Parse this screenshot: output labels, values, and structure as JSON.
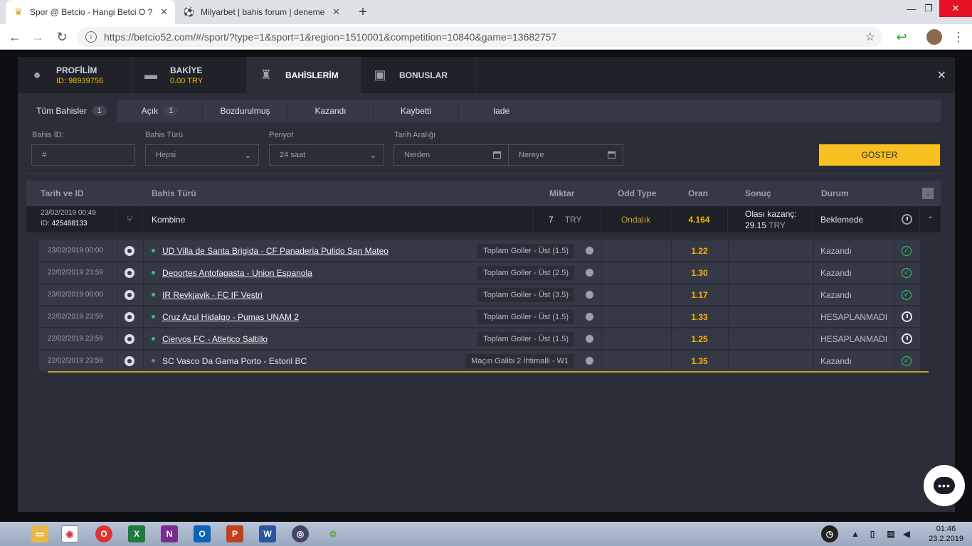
{
  "browser": {
    "tabs": [
      {
        "title": "Spor @ Betcio - Hangi Betci O ?",
        "active": true
      },
      {
        "title": "Milyarbet | bahis forum | deneme",
        "active": false
      }
    ],
    "url": "https://betcio52.com/#/sport/?type=1&sport=1&region=1510001&competition=10840&game=13682757"
  },
  "modal": {
    "tabs": [
      {
        "label": "PROFİLİM",
        "sub": "ID: 98939756"
      },
      {
        "label": "BAKİYE",
        "sub": "0.00 TRY"
      },
      {
        "label": "BAHİSLERİM",
        "sub": ""
      },
      {
        "label": "BONUSLAR",
        "sub": ""
      }
    ],
    "subtabs": [
      {
        "label": "Tüm Bahisler",
        "count": "1"
      },
      {
        "label": "Açık",
        "count": "1"
      },
      {
        "label": "Bozdurulmuş",
        "count": ""
      },
      {
        "label": "Kazandı",
        "count": ""
      },
      {
        "label": "Kaybetti",
        "count": ""
      },
      {
        "label": "Iade",
        "count": ""
      }
    ],
    "filters": {
      "bet_id_label": "Bahis İD:",
      "bet_id_placeholder": "#",
      "bet_type_label": "Bahis Türü",
      "bet_type_value": "Hepsi",
      "period_label": "Periyot",
      "period_value": "24 saat",
      "date_range_label": "Tarih Aralığı",
      "from_placeholder": "Nerden",
      "to_placeholder": "Nereye",
      "show_button": "GÖSTER"
    },
    "table": {
      "headers": [
        "Tarih ve ID",
        "Bahis Türü",
        "Miktar",
        "Odd Type",
        "Oran",
        "Sonuç",
        "Durum"
      ],
      "bet": {
        "date": "23/02/2019 00:49",
        "id_label": "ID:",
        "id": "425488133",
        "type": "Kombine",
        "amount": "7",
        "currency": "TRY",
        "odd_type": "Ondalık",
        "odds": "4.164",
        "possible_win_label": "Olası kazanç:",
        "possible_win": "29.15",
        "possible_win_currency": "TRY",
        "status": "Beklemede"
      },
      "selections": [
        {
          "date": "23/02/2019 00:00",
          "match": "UD Villa de Santa Brigida - CF Panaderia Pulido San Mateo",
          "market": "Toplam Goller - Üst (1.5)",
          "odds": "1.22",
          "status": "Kazandı",
          "state": "won",
          "sport": "football"
        },
        {
          "date": "22/02/2019 23:59",
          "match": "Deportes Antofagasta - Union Espanola",
          "market": "Toplam Goller - Üst (2.5)",
          "odds": "1.30",
          "status": "Kazandı",
          "state": "won",
          "sport": "football"
        },
        {
          "date": "23/02/2019 00:00",
          "match": "IR Reykjavik - FC IF Vestri",
          "market": "Toplam Goller - Üst (3.5)",
          "odds": "1.17",
          "status": "Kazandı",
          "state": "won",
          "sport": "football"
        },
        {
          "date": "22/02/2019 23:59",
          "match": "Cruz Azul Hidalgo - Pumas UNAM 2",
          "market": "Toplam Goller - Üst (1.5)",
          "odds": "1.33",
          "status": "HESAPLANMADI",
          "state": "pending",
          "sport": "football"
        },
        {
          "date": "22/02/2019 23:59",
          "match": "Ciervos FC - Atletico Saltillo",
          "market": "Toplam Goller - Üst (1.5)",
          "odds": "1.25",
          "status": "HESAPLANMADI",
          "state": "pending",
          "sport": "football"
        },
        {
          "date": "22/02/2019 23:59",
          "match": "SC Vasco Da Gama Porto - Estoril BC",
          "market": "Maçın Galibi 2 İhtimalli - W1",
          "odds": "1.35",
          "status": "Kazandı",
          "state": "won",
          "sport": "basketball"
        }
      ]
    }
  },
  "taskbar": {
    "time": "01:46",
    "date": "23.2.2019"
  }
}
